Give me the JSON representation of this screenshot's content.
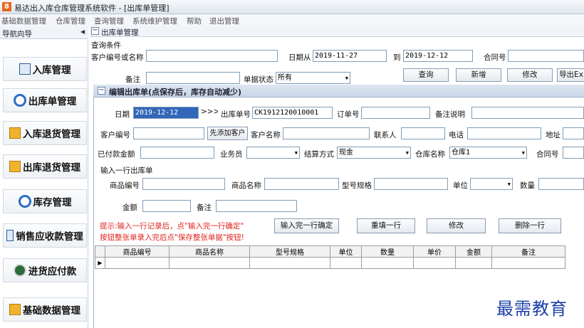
{
  "window": {
    "title": "易达出入库仓库管理系统软件  - [出库单管理]",
    "app_icon": "8"
  },
  "menu": [
    "基础数据管理",
    "仓库管理",
    "查询管理",
    "系统维护管理",
    "帮助",
    "退出管理"
  ],
  "nav": {
    "header": "导航向导",
    "items": [
      {
        "label": "入库管理",
        "icon": "doc-icon"
      },
      {
        "label": "出库单管理",
        "icon": "blue-ring-icon"
      },
      {
        "label": "入库退货管理",
        "icon": "folder-icon"
      },
      {
        "label": "出库退货管理",
        "icon": "folder-icon"
      },
      {
        "label": "库存管理",
        "icon": "blue-ring-icon"
      },
      {
        "label": "销售应收款管理",
        "icon": "doc-icon"
      },
      {
        "label": "进货应付款",
        "icon": "money-icon"
      },
      {
        "label": "基础数据管理",
        "icon": "folder-icon"
      }
    ]
  },
  "main": {
    "header": "出库单管理",
    "query": {
      "section": "查询条件",
      "customer_label": "客户编号或名称",
      "customer_value": "",
      "date_from_label": "日期从",
      "date_from": "2019-11-27",
      "date_to_label": "到",
      "date_to": "2019-12-12",
      "contract_label": "合同号",
      "contract_value": "",
      "remark_label": "备注",
      "remark_value": "",
      "status_label": "单据状态",
      "status_value": "所有",
      "buttons": [
        "查询",
        "新增",
        "修改",
        "导出Ex"
      ]
    }
  },
  "dialog": {
    "title": "编辑出库单(点保存后，库存自动减少)",
    "date_label": "日期",
    "date_value": "2019-12-12",
    "arrow_button": ">>>",
    "order_no_label": "出库单号",
    "order_no_value": "CK1912120010001",
    "order_label": "订单号",
    "order_value": "",
    "note_label": "备注说明",
    "note_value": "",
    "cust_no_label": "客户编号",
    "cust_no_value": "",
    "add_customer_button": "先添加客户",
    "cust_name_label": "客户名称",
    "cust_name_value": "",
    "contact_label": "联系人",
    "contact_value": "",
    "phone_label": "电话",
    "phone_value": "",
    "address_label": "地址",
    "paid_label": "已付款金额",
    "paid_value": "",
    "salesman_label": "业务员",
    "salesman_value": "",
    "settle_label": "结算方式",
    "settle_value": "现金",
    "warehouse_label": "仓库名称",
    "warehouse_value": "仓库1",
    "contract_label": "合同号",
    "line_section": "输入一行出库单",
    "product_no_label": "商品编号",
    "product_name_label": "商品名称",
    "spec_label": "型号规格",
    "unit_label": "单位",
    "qty_label": "数量",
    "amount_label": "金额",
    "remark_label": "备注",
    "hint1": "提示:输入一行记录后，点\"输入完一行确定\"",
    "hint2": "按钮整张单录入完后点\"保存整张单据\"按钮!",
    "buttons": [
      "输入完一行确定",
      "重填一行",
      "修改",
      "删除一行"
    ]
  },
  "grid": {
    "columns": [
      "",
      "商品编号",
      "商品名称",
      "型号规格",
      "单位",
      "数量",
      "单价",
      "金额",
      "备注"
    ],
    "row_marker": "▶"
  },
  "watermark": "最需教育"
}
